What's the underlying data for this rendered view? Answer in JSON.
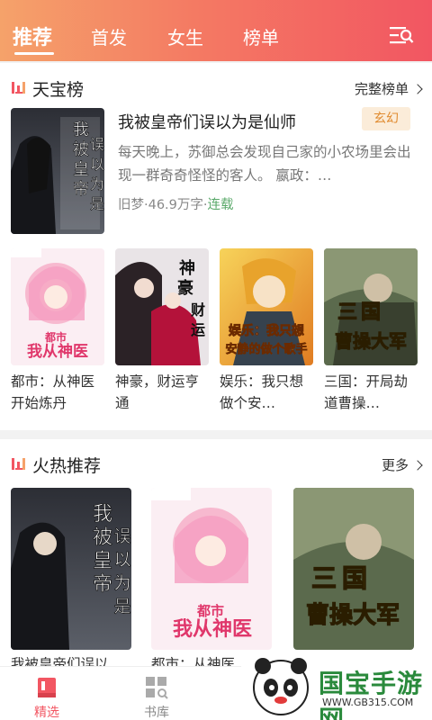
{
  "header": {
    "tabs": [
      {
        "label": "推荐",
        "active": true
      },
      {
        "label": "首发",
        "active": false
      },
      {
        "label": "女生",
        "active": false
      },
      {
        "label": "榜单",
        "active": false
      }
    ],
    "menu_icon": "search-list-icon"
  },
  "tianbao": {
    "title": "天宝榜",
    "more": "完整榜单",
    "featured": {
      "title": "我被皇帝们误以为是仙师",
      "genre": "玄幻",
      "description": "每天晚上，苏御总会发现自己家的小农场里会出现一群奇奇怪怪的客人。 嬴政：…",
      "author": "旧梦",
      "separator1": "·",
      "word_count": "46.9万字",
      "separator2": "·",
      "status": "连载"
    },
    "grid": [
      {
        "title": "都市：从神医开始炼丹"
      },
      {
        "title": "神豪，财运亨通"
      },
      {
        "title": "娱乐：我只想做个安…"
      },
      {
        "title": "三国：开局劫道曹操…"
      }
    ]
  },
  "hot": {
    "title": "火热推荐",
    "more": "更多",
    "items": [
      {
        "title": "我被皇帝们误以"
      },
      {
        "title": "都市：从神医"
      }
    ]
  },
  "bottom_nav": {
    "items": [
      {
        "label": "精选",
        "active": true
      },
      {
        "label": "书库",
        "active": false
      }
    ]
  },
  "watermark": {
    "name": "国宝手游网",
    "url": "WWW.GB315.COM"
  },
  "colors": {
    "brand_red": "#f25662",
    "header_orange": "#f5a26a",
    "status_green": "#5aa96a",
    "badge_text": "#e08a2e"
  }
}
